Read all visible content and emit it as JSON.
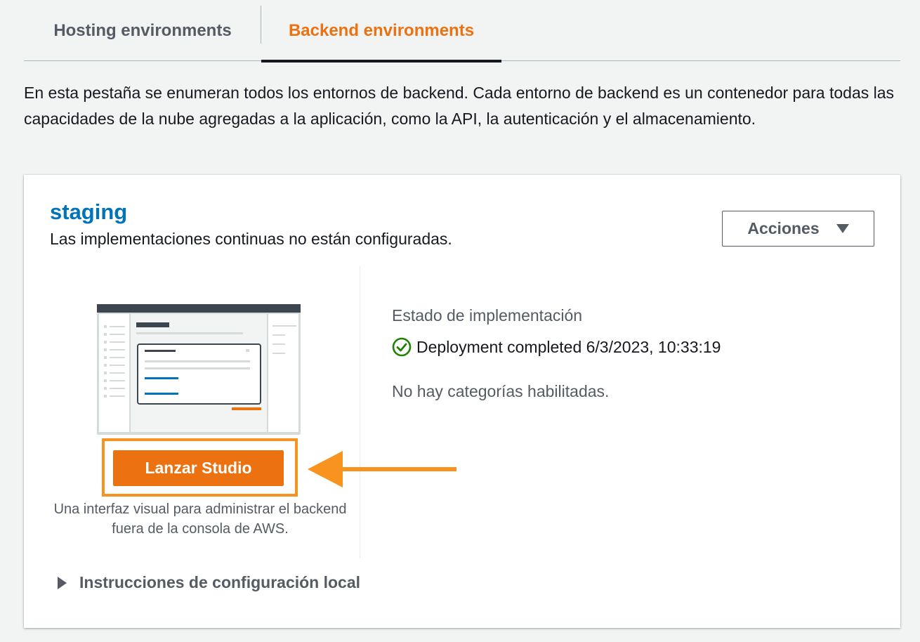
{
  "tabs": {
    "hosting": "Hosting environments",
    "backend": "Backend environments"
  },
  "description": "En esta pestaña se enumeran todos los entornos de backend. Cada entorno de backend es un contenedor para todas las capacidades de la nube agregadas a la aplicación, como la API, la autenticación y el almacenamiento.",
  "card": {
    "env_name": "staging",
    "subtitle": "Las implementaciones continuas no están configuradas.",
    "actions_label": "Acciones",
    "launch_label": "Lanzar Studio",
    "launch_caption": "Una interfaz visual para administrar el backend fuera de la consola de AWS.",
    "status_label": "Estado de implementación",
    "status_text": "Deployment completed 6/3/2023, 10:33:19",
    "categories_text": "No hay categorías habilitadas.",
    "local_setup_label": "Instrucciones de configuración local"
  },
  "colors": {
    "accent": "#ec7211",
    "link": "#0073bb",
    "success": "#1d8102",
    "annotation": "#f7931e"
  },
  "icons": {
    "status": "check-circle-icon",
    "actions": "caret-down-icon",
    "expand": "caret-right-icon",
    "annotation": "arrow-left-icon"
  }
}
